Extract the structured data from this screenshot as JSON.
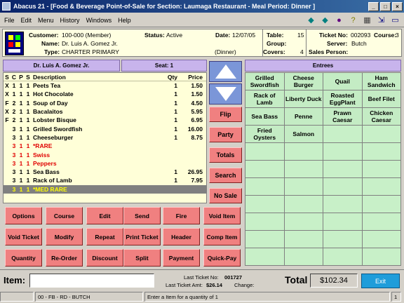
{
  "window": {
    "title": "Abacus 21 - [Food & Beverage Point-of-Sale for Section: Laumaga Restaurant - Meal Period: Dinner ]"
  },
  "menu": [
    "File",
    "Edit",
    "Menu",
    "History",
    "Windows",
    "Help"
  ],
  "info": {
    "customer_label": "Customer:",
    "customer": "100-000 (Member)",
    "name_label": "Name:",
    "name": "Dr. Luis A. Gomez Jr.",
    "type_label": "Type:",
    "type": "CHARTER PRIMARY",
    "status_label": "Status:",
    "status": "Active",
    "date_label": "Date:",
    "date": "12/07/05",
    "period": "(Dinner)",
    "table_label": "Table:",
    "table": "15",
    "group_label": "Group:",
    "group": "",
    "covers_label": "Covers:",
    "covers": "4",
    "ticket_label": "Ticket No:",
    "ticket": "002093",
    "course_label": "Course:",
    "course": "3",
    "server_label": "Server:",
    "server": "Butch",
    "salesperson_label": "Sales Person:",
    "salesperson": ""
  },
  "ticket_header": {
    "guest": "Dr. Luis A. Gomez Jr.",
    "seat": "Seat: 1"
  },
  "columns": {
    "s": "S",
    "c": "C",
    "p": "P",
    "st": "S",
    "desc": "Description",
    "qty": "Qty",
    "price": "Price"
  },
  "lines": [
    {
      "s": "X",
      "c": "1",
      "p": "1",
      "st": "1",
      "desc": "Peets Tea",
      "qty": "1",
      "price": "1.50",
      "mod": false
    },
    {
      "s": "X",
      "c": "1",
      "p": "1",
      "st": "1",
      "desc": "Hot Chocolate",
      "qty": "1",
      "price": "1.50",
      "mod": false
    },
    {
      "s": "F",
      "c": "2",
      "p": "1",
      "st": "1",
      "desc": "Soup of Day",
      "qty": "1",
      "price": "4.50",
      "mod": false
    },
    {
      "s": "X",
      "c": "2",
      "p": "1",
      "st": "1",
      "desc": "Bacalaitos",
      "qty": "1",
      "price": "5.95",
      "mod": false
    },
    {
      "s": "F",
      "c": "2",
      "p": "1",
      "st": "1",
      "desc": "Lobster Bisque",
      "qty": "1",
      "price": "6.95",
      "mod": false
    },
    {
      "s": "",
      "c": "3",
      "p": "1",
      "st": "1",
      "desc": "Grilled Swordfish",
      "qty": "1",
      "price": "16.00",
      "mod": false
    },
    {
      "s": "",
      "c": "3",
      "p": "1",
      "st": "1",
      "desc": "Cheeseburger",
      "qty": "1",
      "price": "8.75",
      "mod": false
    },
    {
      "s": "",
      "c": "3",
      "p": "1",
      "st": "1",
      "desc": "  *RARE",
      "qty": "",
      "price": "",
      "mod": true
    },
    {
      "s": "",
      "c": "3",
      "p": "1",
      "st": "1",
      "desc": "  Swiss",
      "qty": "",
      "price": "",
      "mod": true
    },
    {
      "s": "",
      "c": "3",
      "p": "1",
      "st": "1",
      "desc": "  Peppers",
      "qty": "",
      "price": "",
      "mod": true
    },
    {
      "s": "",
      "c": "3",
      "p": "1",
      "st": "1",
      "desc": "Sea Bass",
      "qty": "1",
      "price": "26.95",
      "mod": false
    },
    {
      "s": "",
      "c": "3",
      "p": "1",
      "st": "1",
      "desc": "Rack of Lamb",
      "qty": "1",
      "price": "7.95",
      "mod": false
    },
    {
      "s": "",
      "c": "3",
      "p": "1",
      "st": "1",
      "desc": "  *MED RARE",
      "qty": "",
      "price": "",
      "mod": true,
      "selected": true
    }
  ],
  "side_buttons": [
    "Flip",
    "Party",
    "Totals",
    "Search",
    "No Sale"
  ],
  "func_buttons": [
    [
      "Options",
      "Course",
      "Edit",
      "Send",
      "Fire",
      "Void Item"
    ],
    [
      "Void Ticket",
      "Modify",
      "Repeat",
      "Print Ticket",
      "Header",
      "Comp Item"
    ],
    [
      "Quantity",
      "Re-Order",
      "Discount",
      "Split",
      "Payment",
      "Quick-Pay"
    ]
  ],
  "entrees_title": "Entrees",
  "entrees": [
    "Grilled Swordfish",
    "Cheese Burger",
    "Quail",
    "Ham Sandwich",
    "Rack of Lamb",
    "Liberty Duck",
    "Roasted EggPlant",
    "Beef Filet",
    "Sea Bass",
    "Penne",
    "Prawn Caesar",
    "Chicken Caesar",
    "Fried Oysters",
    "Salmon"
  ],
  "bottom": {
    "item_label": "Item:",
    "last_ticket_label": "Last Ticket No:",
    "last_ticket": "001727",
    "last_amt_label": "Last Ticket Amt:",
    "last_amt": "$26.14",
    "change_label": "Change:",
    "total_label": "Total",
    "total": "$102.34",
    "exit": "Exit"
  },
  "status": {
    "user": "00 - FB - RD - BUTCH",
    "prompt": "Enter a Item for a quantity of 1",
    "page": "1"
  }
}
